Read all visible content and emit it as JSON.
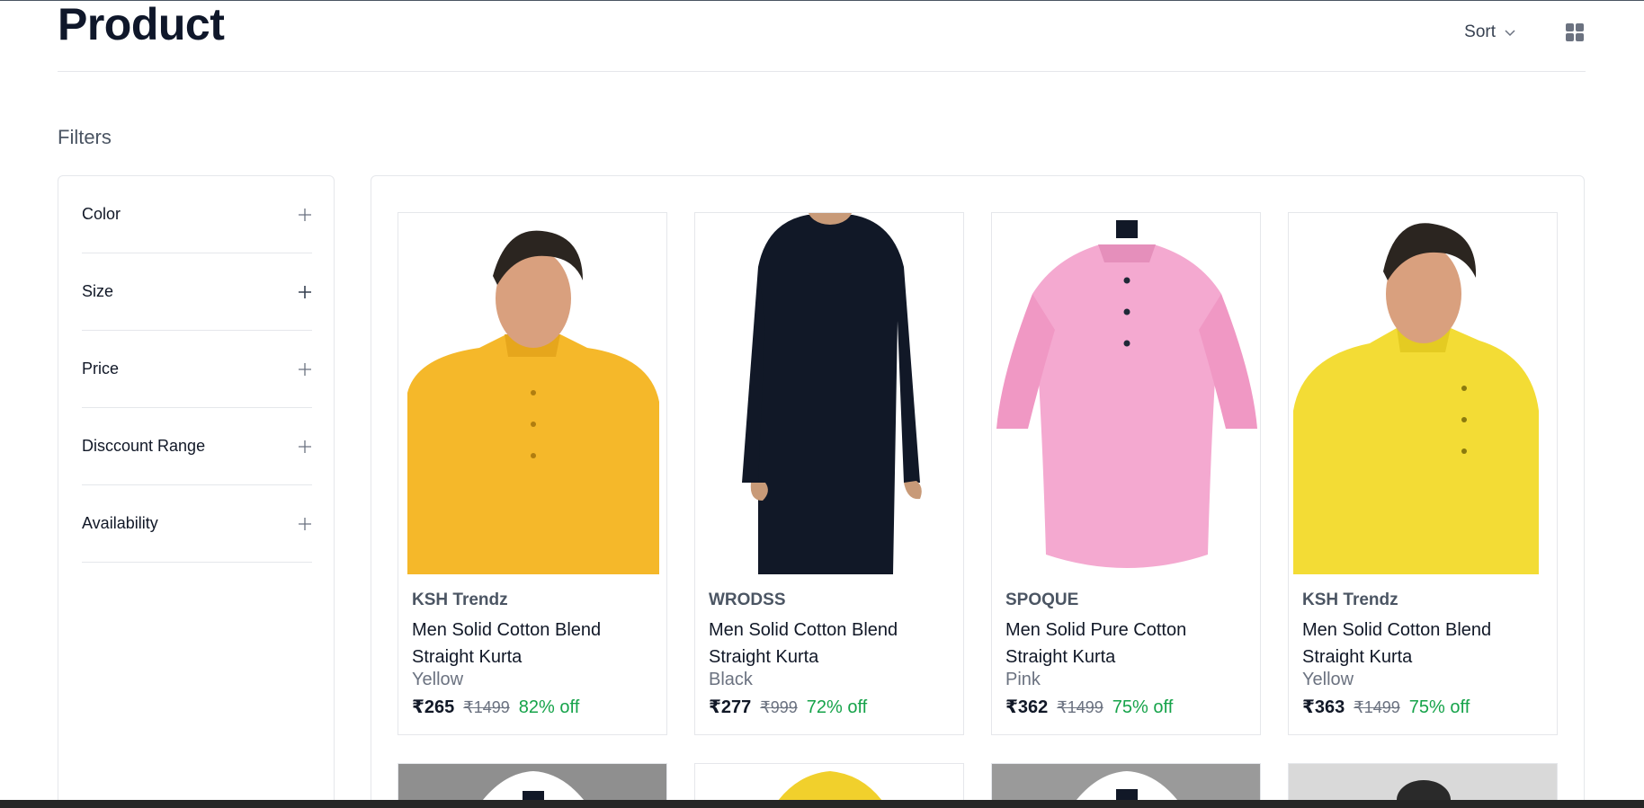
{
  "header": {
    "title": "Product",
    "sort_label": "Sort"
  },
  "filters": {
    "title": "Filters",
    "items": [
      {
        "label": "Color"
      },
      {
        "label": "Size"
      },
      {
        "label": "Price"
      },
      {
        "label": "Disccount Range"
      },
      {
        "label": "Availability"
      }
    ]
  },
  "products": [
    {
      "brand": "KSH Trendz",
      "name": "Men Solid Cotton Blend Straight Kurta",
      "color": "Yellow",
      "price": "₹265",
      "mrp": "₹1499",
      "discount": "82% off",
      "swatch": "#f5b82a"
    },
    {
      "brand": "WRODSS",
      "name": "Men Solid Cotton Blend Straight Kurta",
      "color": "Black",
      "price": "₹277",
      "mrp": "₹999",
      "discount": "72% off",
      "swatch": "#111827"
    },
    {
      "brand": "SPOQUE",
      "name": "Men Solid Pure Cotton Straight Kurta",
      "color": "Pink",
      "price": "₹362",
      "mrp": "₹1499",
      "discount": "75% off",
      "swatch": "#f4a9d0"
    },
    {
      "brand": "KSH Trendz",
      "name": "Men Solid Cotton Blend Straight Kurta",
      "color": "Yellow",
      "price": "₹363",
      "mrp": "₹1499",
      "discount": "75% off",
      "swatch": "#f3dc35"
    }
  ],
  "next_row_swatches": [
    "#ffffff",
    "#f1d02c",
    "#ffffff",
    "#2a2a2a"
  ],
  "colors": {
    "accent_green": "#16a34a",
    "title": "#0f172a",
    "border": "#e5e7eb"
  }
}
